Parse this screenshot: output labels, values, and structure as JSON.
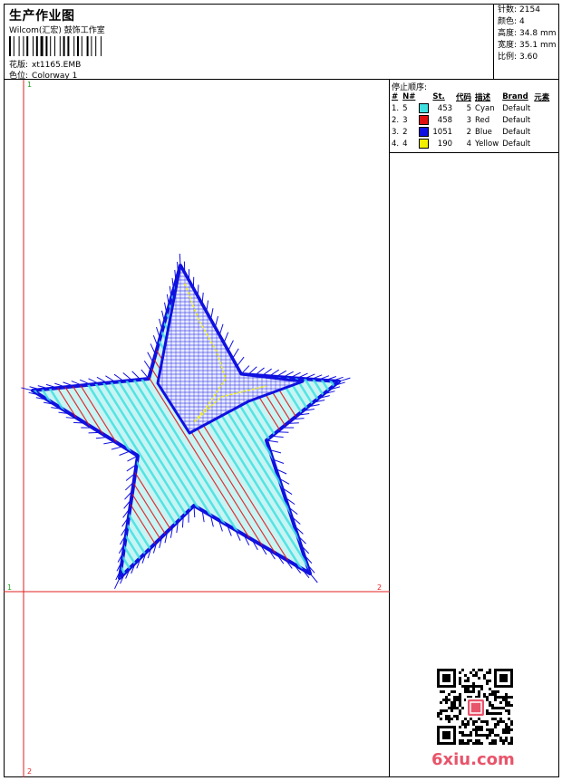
{
  "header": {
    "title": "生产作业图",
    "company": "Wilcom(汇宏) 鼓饰工作室",
    "design_label": "花版:",
    "design_value": "xt1165.EMB",
    "colorway_label": "色位:",
    "colorway_value": "Colorway 1"
  },
  "stats": {
    "stitches_label": "针数:",
    "stitches_value": "2154",
    "colors_label": "颜色:",
    "colors_value": "4",
    "height_label": "高度:",
    "height_value": "34.8 mm",
    "width_label": "宽度:",
    "width_value": "35.1 mm",
    "scale_label": "比例:",
    "scale_value": "3.60"
  },
  "stop_sequence": {
    "title": "停止顺序:",
    "headers": [
      "#",
      "N#",
      "St.",
      "代码",
      "描述",
      "Brand",
      "元素"
    ],
    "rows": [
      {
        "idx": "1.",
        "n": "5",
        "color": "#40e0e0",
        "st": "453",
        "code": "5",
        "desc": "Cyan",
        "brand": "Default"
      },
      {
        "idx": "2.",
        "n": "3",
        "color": "#e01010",
        "st": "458",
        "code": "3",
        "desc": "Red",
        "brand": "Default"
      },
      {
        "idx": "3.",
        "n": "2",
        "color": "#1010e0",
        "st": "1051",
        "code": "2",
        "desc": "Blue",
        "brand": "Default"
      },
      {
        "idx": "4.",
        "n": "4",
        "color": "#f0f000",
        "st": "190",
        "code": "4",
        "desc": "Yellow",
        "brand": "Default"
      }
    ]
  },
  "axes": {
    "top_left_marker": "1",
    "bottom_marker": "2",
    "left_marker": "1",
    "right_marker": "2",
    "line_color": "#e02020"
  },
  "watermark": {
    "text": "6xiu.com",
    "color": "#e8546a"
  },
  "palette": {
    "cyan": "#40e0e0",
    "red": "#e01010",
    "blue": "#1010e0",
    "yellow": "#f0f000"
  }
}
